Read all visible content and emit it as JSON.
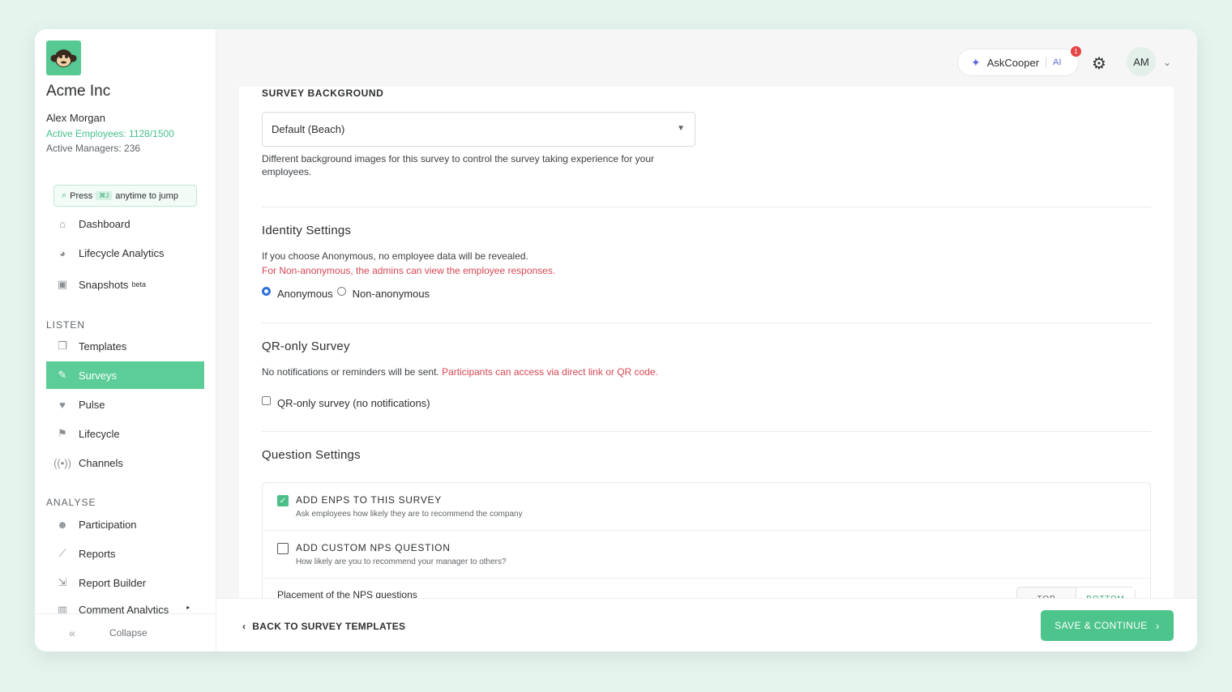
{
  "sidebar": {
    "company": "Acme Inc",
    "user_name": "Alex Morgan",
    "active_employees": "Active Employees: 1128/1500",
    "active_managers": "Active Managers: 236",
    "jump": {
      "press": "Press",
      "shortcut": "⌘J",
      "suffix": "anytime to jump"
    },
    "nav_top": [
      {
        "label": "Dashboard",
        "icon": "home-icon"
      },
      {
        "label": "Lifecycle Analytics",
        "icon": "pie-chart-icon"
      },
      {
        "label": "Snapshots",
        "icon": "camera-icon",
        "badge": "beta"
      }
    ],
    "listen_label": "LISTEN",
    "nav_listen": [
      {
        "label": "Templates",
        "icon": "copy-icon"
      },
      {
        "label": "Surveys",
        "icon": "pencil-icon"
      },
      {
        "label": "Pulse",
        "icon": "heartbeat-icon"
      },
      {
        "label": "Lifecycle",
        "icon": "flag-icon"
      },
      {
        "label": "Channels",
        "icon": "broadcast-icon"
      }
    ],
    "analyse_label": "ANALYSE",
    "nav_analyse": [
      {
        "label": "Participation",
        "icon": "user-check-icon"
      },
      {
        "label": "Reports",
        "icon": "line-chart-icon"
      },
      {
        "label": "Report Builder",
        "icon": "file-export-icon"
      },
      {
        "label": "Comment Analytics",
        "icon": "bar-chart-icon"
      }
    ],
    "collapse": "Collapse"
  },
  "topbar": {
    "askcooper": "AskCooper",
    "ai": "AI",
    "notification_count": "1",
    "avatar_initials": "AM"
  },
  "background": {
    "heading": "SURVEY BACKGROUND",
    "selected": "Default (Beach)",
    "help": "Different background images for this survey to control the survey taking experience for your employees."
  },
  "identity": {
    "heading": "Identity Settings",
    "info": "If you choose Anonymous, no employee data will be revealed.",
    "warning": "For Non-anonymous, the admins can view the employee responses.",
    "option_anonymous": "Anonymous",
    "option_non_anonymous": "Non-anonymous"
  },
  "qr": {
    "heading": "QR-only Survey",
    "info": "No notifications or reminders will be sent.",
    "warning": "Participants can access via direct link or QR code.",
    "checkbox_label": "QR-only survey (no notifications)"
  },
  "questions": {
    "heading": "Question Settings",
    "enps_title": "ADD ENPS TO THIS SURVEY",
    "enps_sub": "Ask employees how likely they are to recommend the company",
    "nps_title": "ADD CUSTOM NPS QUESTION",
    "nps_sub": "How likely are you to recommend your manager to others?",
    "placement_label": "Placement of the NPS questions",
    "placement_top": "TOP",
    "placement_bottom": "BOTTOM"
  },
  "footer": {
    "back": "BACK TO SURVEY TEMPLATES",
    "save": "SAVE & CONTINUE"
  },
  "colors": {
    "accent": "#5ccd98",
    "warning": "#d64652",
    "link": "#45c08a"
  }
}
